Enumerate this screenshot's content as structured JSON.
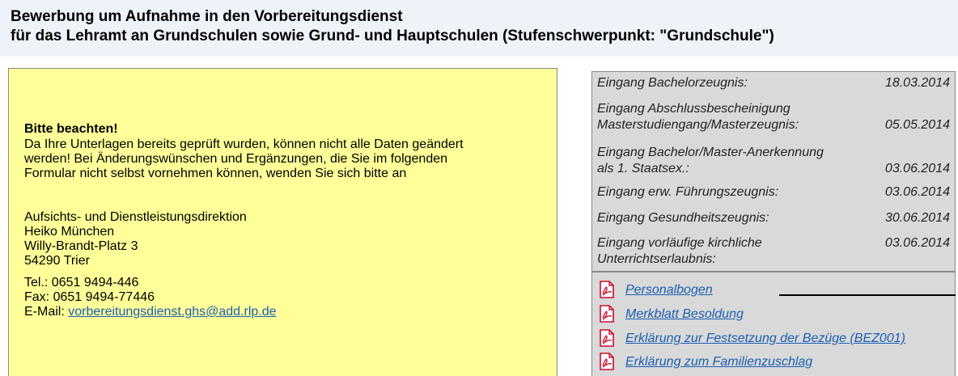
{
  "header": {
    "line1": "Bewerbung um Aufnahme in den Vorbereitungsdienst",
    "line2": "für das Lehramt an Grundschulen sowie Grund- und Hauptschulen (Stufenschwerpunkt: \"Grundschule\")"
  },
  "notice": {
    "title": "Bitte beachten!",
    "lines": [
      "Da Ihre Unterlagen bereits geprüft wurden, können nicht alle Daten geändert",
      "werden! Bei Änderungswünschen und Ergänzungen, die Sie im folgenden",
      "Formular nicht selbst vornehmen können, wenden Sie sich bitte an"
    ],
    "contact": {
      "org": "Aufsichts- und Dienstleistungsdirektion",
      "name": "Heiko München",
      "street": "Willy-Brandt-Platz 3",
      "city": "54290 Trier",
      "tel": "Tel.: 0651 9494-446",
      "fax": "Fax: 0651 9494-77446",
      "email_label": "E-Mail:",
      "email": "vorbereitungsdienst.ghs@add.rlp.de"
    }
  },
  "receipts": [
    {
      "label": "Eingang Bachelorzeugnis:",
      "date": "18.03.2014"
    },
    {
      "label1": "Eingang Abschlussbescheinigung",
      "label2": "Masterstudiengang/Masterzeugnis:",
      "date": "05.05.2014"
    },
    {
      "label1": "Eingang Bachelor/Master-Anerkennung",
      "label2": "als 1. Staatsex.:",
      "date": "03.06.2014"
    },
    {
      "label": "Eingang erw. Führungszeugnis:",
      "date": "03.06.2014"
    },
    {
      "label": "Eingang Gesundheitszeugnis:",
      "date": "30.06.2014"
    },
    {
      "label1": "Eingang vorläufige kirchliche",
      "label2": "Unterrichtserlaubnis:",
      "date": "03.06.2014"
    }
  ],
  "documents": [
    {
      "label": "Personalbogen",
      "icon": "pdf-icon"
    },
    {
      "label": "Merkblatt Besoldung",
      "icon": "pdf-icon"
    },
    {
      "label": "Erklärung zur Festsetzung der Bezüge (BEZ001)",
      "icon": "pdf-icon"
    },
    {
      "label": "Erklärung zum Familienzuschlag",
      "icon": "pdf-icon"
    }
  ],
  "colors": {
    "header_bg": "#eef3fa",
    "notice_bg": "#ffff99",
    "panel_bg": "#d9d9d9",
    "link": "#1a5fb4",
    "pdf_red": "#c8102e"
  }
}
